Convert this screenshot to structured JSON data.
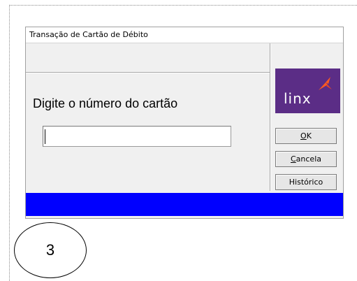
{
  "dialog": {
    "title": "Transação de Cartão de Débito",
    "prompt": "Digite o número do cartão",
    "card_number_value": "",
    "card_number_placeholder": ""
  },
  "logo": {
    "text": "linx",
    "icon": "linx-arrow-mark",
    "color": "#5b2d86",
    "accent": "#ff5a1f"
  },
  "buttons": {
    "ok": {
      "label": "OK",
      "mnemonic": "O",
      "rest": "K"
    },
    "cancel": {
      "label": "Cancela",
      "mnemonic": "C",
      "rest": "ancela"
    },
    "history": {
      "label": "Histórico"
    }
  },
  "status_bar": {
    "color": "#0000ff",
    "text": ""
  },
  "step_marker": {
    "number": "3"
  }
}
